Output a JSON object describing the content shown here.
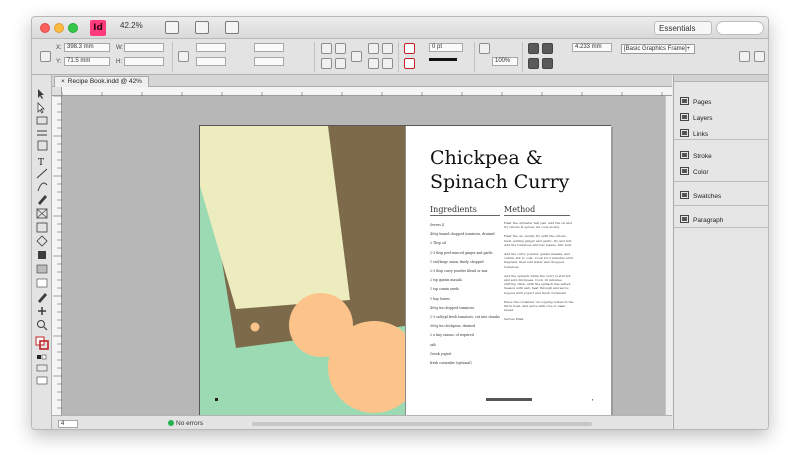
{
  "app": {
    "logo_text": "Id",
    "zoom": "42.2%",
    "workspace": "Essentials",
    "search_placeholder": ""
  },
  "control": {
    "x_label": "X:",
    "x_value": "398.3 mm",
    "y_label": "Y:",
    "y_value": "71.5 mm",
    "w_label": "W:",
    "h_label": "H:",
    "stroke_weight": "0 pt",
    "opacity": "100%",
    "frame_style": "[Basic Graphics Frame]+",
    "offset_value": "4.233 mm"
  },
  "document": {
    "tab_title": "Recipe Book.indd @ 42%"
  },
  "recipe": {
    "title_line1": "Chickpea &",
    "title_line2": "Spinach Curry",
    "ingredients_heading": "Ingredients",
    "method_heading": "Method",
    "ingredients": [
      "Serves 4",
      "400g tinned chopped tomatoes, drained",
      "2 Tbsp oil",
      "2-3 tbsp peel-minced ginger and garlic",
      "1 red/large onion, finely chopped",
      "2-3 tbsp curry powder blend or mix",
      "2 tsp garam masala",
      "1 tsp cumin seeds",
      "1 bay leaves",
      "400g tin chopped tomatoes",
      "2-3 salt/spl fresh tomatoes, cut into chunks",
      "300g tin chickpeas, drained",
      "2 x tiny onions, of required",
      "salt",
      "Greek yogurt",
      "fresh coriander (optional)"
    ],
    "method": [
      "Heat the oil/water bell pan. Add the oil and fry onions & spices, let cook slowly.",
      "Heat the oil. Gently fry until the onions melt, adding ginger and garlic, fry and stir. Add the tomatoes and bay leaves. Stir well.",
      "Add the curry powder, garam masala, and cumin, stir to coat. Cook for 2 minutes until fragrant, then add water and chopped tomatoes.",
      "Add the spinach while the curry is still hot and add chickpeas. Cook 10 minutes, stirring often, until the spinach has wilted. Season with salt, heat through and serve topped with yogurt and fresh coriander.",
      "Place the coriander on topping rested in the thick bowl, and serve with rice or naan bread.",
      "Serves Pliak"
    ],
    "page_left": "4",
    "page_right": "5"
  },
  "panels": [
    {
      "label": "Pages",
      "icon": "pages-icon"
    },
    {
      "label": "Layers",
      "icon": "layers-icon"
    },
    {
      "label": "Links",
      "icon": "links-icon"
    },
    {
      "label": "Stroke",
      "icon": "stroke-icon"
    },
    {
      "label": "Color",
      "icon": "color-icon"
    },
    {
      "label": "Swatches",
      "icon": "swatches-icon"
    },
    {
      "label": "Paragraph",
      "icon": "paragraph-icon"
    }
  ],
  "status": {
    "page_field": "4",
    "errors_label": "No errors"
  },
  "colors": {
    "mint": "#9cdab3",
    "olive": "#7c6a4b",
    "cream": "#ececbf",
    "peach": "#fcc48b",
    "app_pink": "#ff3b7f"
  }
}
